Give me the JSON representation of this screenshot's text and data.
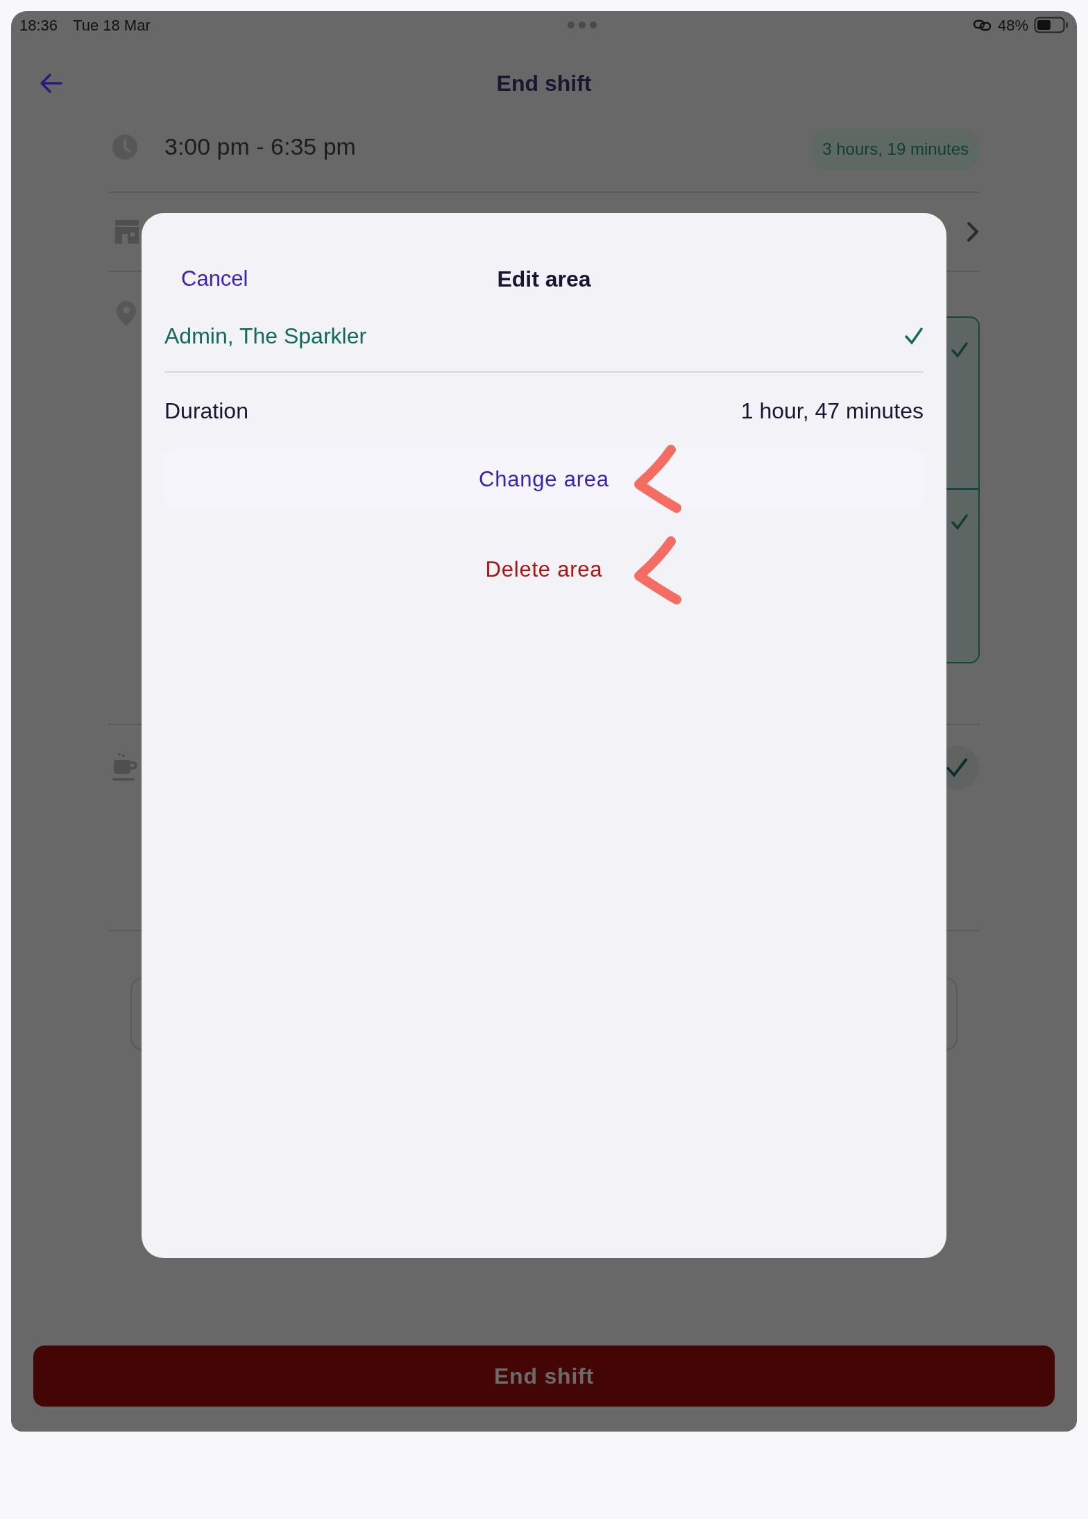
{
  "status_bar": {
    "time": "18:36",
    "date": "Tue 18 Mar",
    "battery": "48%"
  },
  "header": {
    "title": "End shift"
  },
  "shift": {
    "time_range": "3:00 pm - 6:35 pm",
    "total": "3 hours, 19 minutes"
  },
  "dialog": {
    "cancel": "Cancel",
    "title": "Edit area",
    "area": {
      "name": "Admin, The Sparkler",
      "selected": true
    },
    "duration_label": "Duration",
    "duration": "1 hour, 47 minutes",
    "actions": [
      {
        "label": "Change area",
        "kind": "primary"
      },
      {
        "label": "Delete area",
        "kind": "destructive"
      }
    ]
  },
  "footer": {
    "button": "End shift"
  }
}
